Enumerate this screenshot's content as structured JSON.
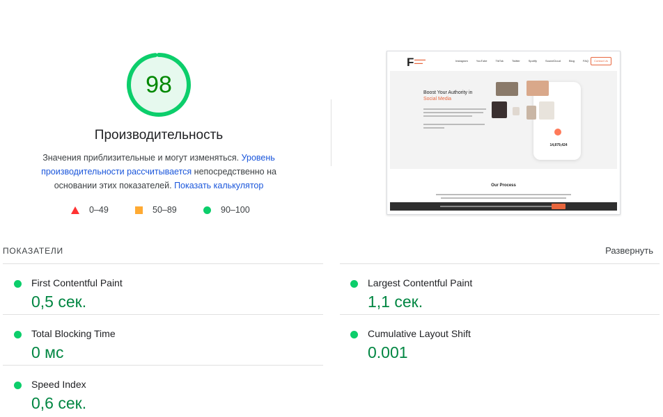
{
  "gauge": {
    "score": "98",
    "fraction": 0.98,
    "color": "#0cce6b"
  },
  "performance": {
    "title": "Производительность",
    "desc_prefix": "Значения приблизительные и могут изменяться.",
    "desc_link1": "Уровень производительности рассчитывается",
    "desc_middle": "непосредственно на основании этих показателей.",
    "desc_link2": "Показать калькулятор"
  },
  "legend": [
    {
      "range": "0–49",
      "shape": "triangle",
      "color": "#ff3333"
    },
    {
      "range": "50–89",
      "shape": "square",
      "color": "#ffaa33"
    },
    {
      "range": "90–100",
      "shape": "circle",
      "color": "#0cce6b"
    }
  ],
  "screenshot": {
    "logo_letter": "F",
    "nav_items": [
      "Instagram",
      "YouTube",
      "TikTok",
      "Twitter",
      "Spotify",
      "SoundCloud",
      "Blog",
      "FAQ"
    ],
    "contact": "Contact Us",
    "hero_line1": "Boost Your Authority in",
    "hero_line2": "Social Media",
    "counter": "14,879,424",
    "process_title": "Our Process"
  },
  "metrics": {
    "header": "ПОКАЗАТЕЛИ",
    "expand": "Развернуть",
    "items": [
      {
        "name": "First Contentful Paint",
        "value": "0,5 сек.",
        "status_color": "#0cce6b"
      },
      {
        "name": "Largest Contentful Paint",
        "value": "1,1 сек.",
        "status_color": "#0cce6b"
      },
      {
        "name": "Total Blocking Time",
        "value": "0 мс",
        "status_color": "#0cce6b"
      },
      {
        "name": "Cumulative Layout Shift",
        "value": "0.001",
        "status_color": "#0cce6b"
      },
      {
        "name": "Speed Index",
        "value": "0,6 сек.",
        "status_color": "#0cce6b"
      }
    ]
  }
}
